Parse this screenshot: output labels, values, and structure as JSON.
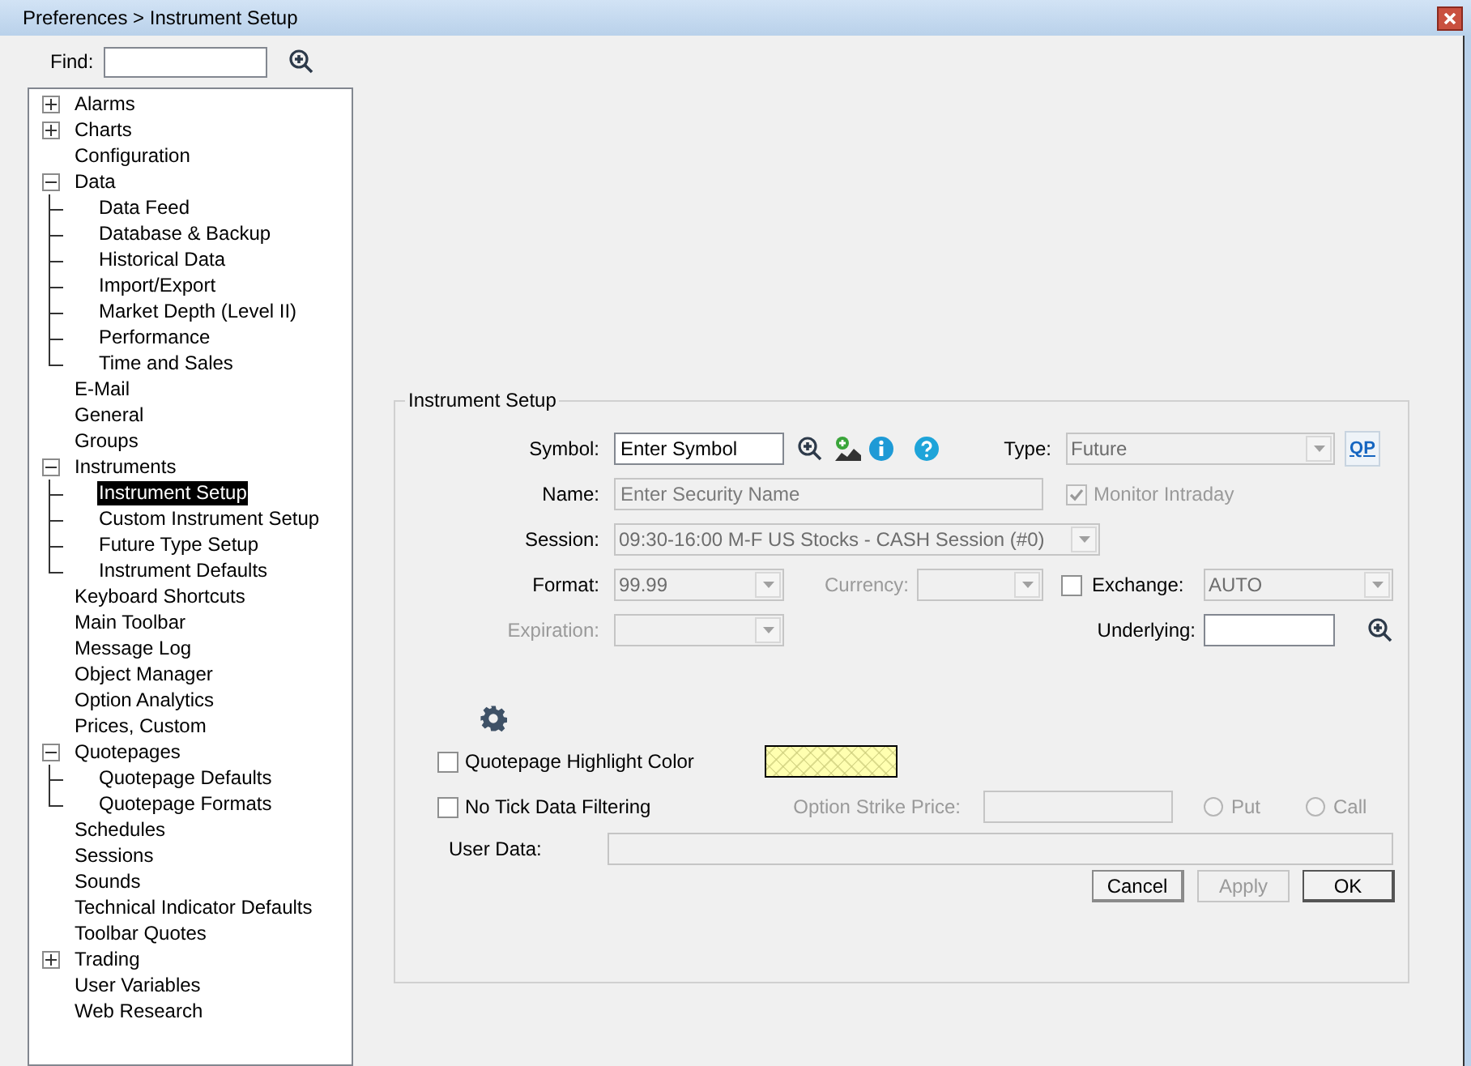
{
  "window": {
    "title": "Preferences > Instrument Setup"
  },
  "find": {
    "label": "Find:"
  },
  "tree": [
    {
      "label": "Alarms",
      "kind": "group",
      "expanded": false,
      "selected": false
    },
    {
      "label": "Charts",
      "kind": "group",
      "expanded": false,
      "selected": false
    },
    {
      "label": "Configuration",
      "kind": "leaf",
      "selected": false
    },
    {
      "label": "Data",
      "kind": "group",
      "expanded": true,
      "selected": false,
      "children": [
        {
          "label": "Data Feed",
          "selected": false
        },
        {
          "label": "Database & Backup",
          "selected": false
        },
        {
          "label": "Historical Data",
          "selected": false
        },
        {
          "label": "Import/Export",
          "selected": false
        },
        {
          "label": "Market Depth (Level II)",
          "selected": false
        },
        {
          "label": "Performance",
          "selected": false
        },
        {
          "label": "Time and Sales",
          "selected": false
        }
      ]
    },
    {
      "label": "E-Mail",
      "kind": "leaf",
      "selected": false
    },
    {
      "label": "General",
      "kind": "leaf",
      "selected": false
    },
    {
      "label": "Groups",
      "kind": "leaf",
      "selected": false
    },
    {
      "label": "Instruments",
      "kind": "group",
      "expanded": true,
      "selected": false,
      "children": [
        {
          "label": "Instrument Setup",
          "selected": true
        },
        {
          "label": "Custom Instrument Setup",
          "selected": false
        },
        {
          "label": "Future Type Setup",
          "selected": false
        },
        {
          "label": "Instrument Defaults",
          "selected": false
        }
      ]
    },
    {
      "label": "Keyboard Shortcuts",
      "kind": "leaf",
      "selected": false
    },
    {
      "label": "Main Toolbar",
      "kind": "leaf",
      "selected": false
    },
    {
      "label": "Message Log",
      "kind": "leaf",
      "selected": false
    },
    {
      "label": "Object Manager",
      "kind": "leaf",
      "selected": false
    },
    {
      "label": "Option Analytics",
      "kind": "leaf",
      "selected": false
    },
    {
      "label": "Prices, Custom",
      "kind": "leaf",
      "selected": false
    },
    {
      "label": "Quotepages",
      "kind": "group",
      "expanded": true,
      "selected": false,
      "children": [
        {
          "label": "Quotepage Defaults",
          "selected": false
        },
        {
          "label": "Quotepage Formats",
          "selected": false
        }
      ]
    },
    {
      "label": "Schedules",
      "kind": "leaf",
      "selected": false
    },
    {
      "label": "Sessions",
      "kind": "leaf",
      "selected": false
    },
    {
      "label": "Sounds",
      "kind": "leaf",
      "selected": false
    },
    {
      "label": "Technical Indicator Defaults",
      "kind": "leaf",
      "selected": false
    },
    {
      "label": "Toolbar Quotes",
      "kind": "leaf",
      "selected": false
    },
    {
      "label": "Trading",
      "kind": "group",
      "expanded": false,
      "selected": false
    },
    {
      "label": "User Variables",
      "kind": "leaf",
      "selected": false
    },
    {
      "label": "Web Research",
      "kind": "leaf",
      "selected": false
    }
  ],
  "setup": {
    "title": "Instrument Setup",
    "symbol": {
      "label": "Symbol:",
      "value": "Enter Symbol",
      "disabled": false
    },
    "type": {
      "label": "Type:",
      "value": "Future",
      "disabled": true
    },
    "qp_button": "QP",
    "name": {
      "label": "Name:",
      "placeholder": "Enter Security Name",
      "disabled": true
    },
    "monitor_intraday": {
      "label": "Monitor Intraday",
      "checked": true,
      "disabled": true
    },
    "session": {
      "label": "Session:",
      "value": "09:30-16:00 M-F US Stocks - CASH Session (#0)",
      "disabled": true
    },
    "format": {
      "label": "Format:",
      "value": "99.99",
      "disabled": true
    },
    "currency": {
      "label": "Currency:",
      "disabled": true
    },
    "exchange_check": {
      "checked": false,
      "disabled": false
    },
    "exchange": {
      "label": "Exchange:",
      "value": "AUTO",
      "disabled": true
    },
    "expiration": {
      "label": "Expiration:",
      "disabled": true
    },
    "underlying": {
      "label": "Underlying:",
      "disabled": false
    },
    "highlight": {
      "label": "Quotepage Highlight Color",
      "checked": false,
      "color": "#ffffb0"
    },
    "no_tick": {
      "label": "No Tick Data Filtering",
      "checked": false
    },
    "strike": {
      "label": "Option Strike Price:",
      "disabled": true
    },
    "radios": [
      {
        "label": "Put",
        "selected": false,
        "disabled": true
      },
      {
        "label": "Call",
        "selected": false,
        "disabled": true
      }
    ],
    "user_data": {
      "label": "User Data:",
      "disabled": true
    },
    "buttons": [
      {
        "label": "Cancel",
        "disabled": false,
        "default": false
      },
      {
        "label": "Apply",
        "disabled": true,
        "default": false
      },
      {
        "label": "OK",
        "disabled": false,
        "default": true
      }
    ]
  }
}
